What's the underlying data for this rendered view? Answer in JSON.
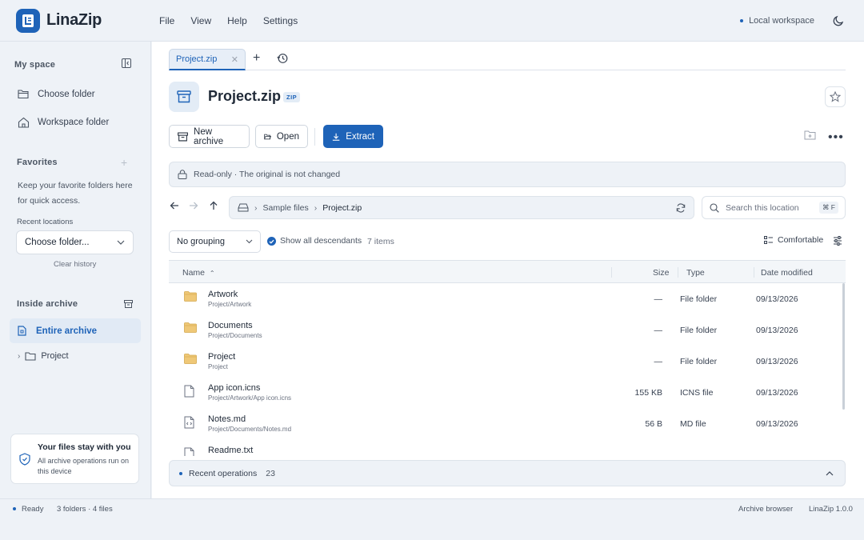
{
  "app": {
    "name": "LinaZip",
    "menu": [
      "File",
      "View",
      "Help",
      "Settings"
    ],
    "workspace": "Local workspace",
    "accent": "#1e63b8"
  },
  "sidebar": {
    "my_space": "My space",
    "items": [
      {
        "label": "Choose folder",
        "icon": "folder-open-icon"
      },
      {
        "label": "Workspace folder",
        "icon": "home-icon"
      }
    ],
    "favorites": {
      "title": "Favorites",
      "hint": "Keep your favorite folders here for quick access.",
      "recent_label": "Recent locations",
      "select_value": "Choose folder...",
      "clear": "Clear history"
    },
    "inside_archive": {
      "title": "Inside archive",
      "entire": "Entire archive",
      "tree": [
        "Project"
      ]
    },
    "privacy": {
      "title": "Your files stay with you",
      "desc": "All archive operations run on this device"
    }
  },
  "tabs": [
    {
      "label": "Project.zip",
      "active": true
    }
  ],
  "file": {
    "name": "Project.zip",
    "badge": "ZIP"
  },
  "toolbar": {
    "new_archive": "New archive",
    "open": "Open",
    "extract": "Extract"
  },
  "notice": "Read-only · The original is not changed",
  "path": {
    "segments": [
      "Sample files",
      "Project.zip"
    ]
  },
  "search": {
    "placeholder": "Search this location",
    "shortcut": "⌘ F"
  },
  "view": {
    "grouping": "No grouping",
    "show_descendants": "Show all descendants",
    "show_descendants_checked": true,
    "items_count": "7 items",
    "density": "Comfortable"
  },
  "table": {
    "columns": {
      "name": "Name",
      "size": "Size",
      "type": "Type",
      "date": "Date modified"
    },
    "sort": {
      "column": "name",
      "direction": "ascending"
    },
    "rows": [
      {
        "name": "Artwork",
        "path": "Project/Artwork",
        "size": "—",
        "type": "File folder",
        "date": "09/13/2026",
        "kind": "folder"
      },
      {
        "name": "Documents",
        "path": "Project/Documents",
        "size": "—",
        "type": "File folder",
        "date": "09/13/2026",
        "kind": "folder"
      },
      {
        "name": "Project",
        "path": "Project",
        "size": "—",
        "type": "File folder",
        "date": "09/13/2026",
        "kind": "folder"
      },
      {
        "name": "App icon.icns",
        "path": "Project/Artwork/App icon.icns",
        "size": "155 KB",
        "type": "ICNS file",
        "date": "09/13/2026",
        "kind": "file"
      },
      {
        "name": "Notes.md",
        "path": "Project/Documents/Notes.md",
        "size": "56 B",
        "type": "MD file",
        "date": "09/13/2026",
        "kind": "code"
      },
      {
        "name": "Readme.txt",
        "path": "",
        "size": "",
        "type": "",
        "date": "",
        "kind": "file"
      }
    ]
  },
  "recent_ops": {
    "label": "Recent operations",
    "count": "23"
  },
  "status": {
    "state": "Ready",
    "summary": "3 folders · 4 files",
    "mode": "Archive browser",
    "version": "LinaZip 1.0.0"
  }
}
